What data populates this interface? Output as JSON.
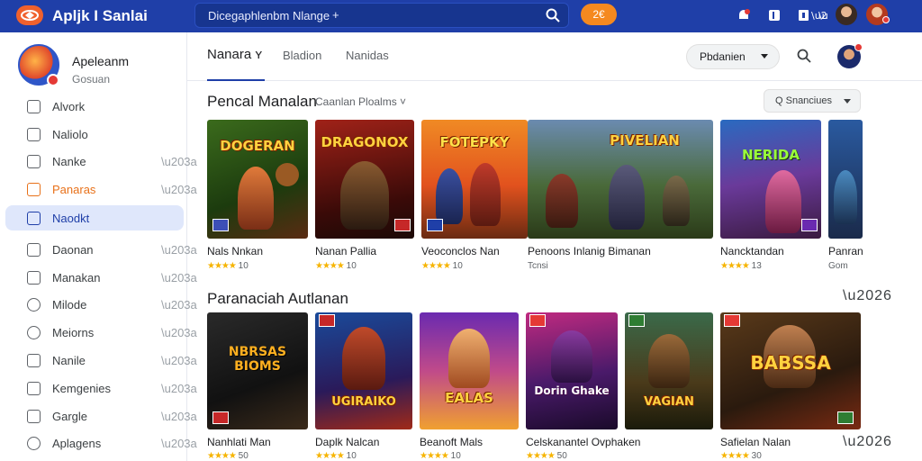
{
  "topbar": {
    "app_name": "Apljk I Sanlai",
    "search_text": "Dicegaphlenbm Nlange",
    "search_plus": "+",
    "pill_label": "2€"
  },
  "sidebar": {
    "profile_name": "Apeleanm",
    "profile_sub": "Gosuan",
    "items": [
      {
        "label": "Alvork"
      },
      {
        "label": "Naliolo"
      },
      {
        "label": "Nanke"
      },
      {
        "label": "Panaras"
      },
      {
        "label": "Naodkt"
      },
      {
        "label": "Daonan"
      },
      {
        "label": "Manakan"
      },
      {
        "label": "Milode"
      },
      {
        "label": "Meiorns"
      },
      {
        "label": "Nanile"
      },
      {
        "label": "Kemgenies"
      },
      {
        "label": "Gargle"
      },
      {
        "label": "Aplagens"
      }
    ]
  },
  "header": {
    "tabs": [
      "Nanara ʏ",
      "Bladion",
      "Nanidas"
    ],
    "sort_label": "Pbdanien"
  },
  "section1": {
    "title": "Pencal Manalan",
    "subtitle": "Caanlan Ploalms ˅",
    "filter_label": "Q  Snanciues",
    "cards": [
      {
        "title": "Nals Nnkan",
        "meta": "★★★★ 10",
        "art": "DOGERAN"
      },
      {
        "title": "Nanan Pallia",
        "meta": "★★★★ 10",
        "art": "DRAGONOX"
      },
      {
        "title": "Veoconclos Nan",
        "meta": "★★★★ 10",
        "art": "FOTEPKY"
      },
      {
        "title": "Penoons Inlanig Bimanan",
        "meta": "Tcnsi",
        "art": "PIVELIAN"
      },
      {
        "title": "Nancktandan",
        "meta": "★★★★ 13",
        "art": "NERIDA"
      },
      {
        "title": "Panran",
        "meta": "Gom",
        "art": ""
      }
    ]
  },
  "section2": {
    "title": "Paranaciah Autlanan",
    "cards": [
      {
        "title": "Nanhlati Man",
        "meta": "★★★★ 50",
        "art": "NBRSAS BIOMS"
      },
      {
        "title": "Daplk Nalcan",
        "meta": "★★★★ 10",
        "art": "UGIRAIKO"
      },
      {
        "title": "Beanoft Mals",
        "meta": "★★★★ 10",
        "art": "EALAS"
      },
      {
        "title": "Celskanantel Ovphaken",
        "meta": "★★★★ 50",
        "art": "Dorin Ghake"
      },
      {
        "title": "",
        "meta": "",
        "art": "VAGIAN"
      },
      {
        "title": "Safielan Nalan",
        "meta": "★★★★ 30",
        "art": "BABSSA"
      }
    ]
  },
  "colors": {
    "topbar": "#1f3fa8",
    "accent": "#1f3fa8",
    "orange": "#e8711a",
    "star": "#f6b400"
  }
}
